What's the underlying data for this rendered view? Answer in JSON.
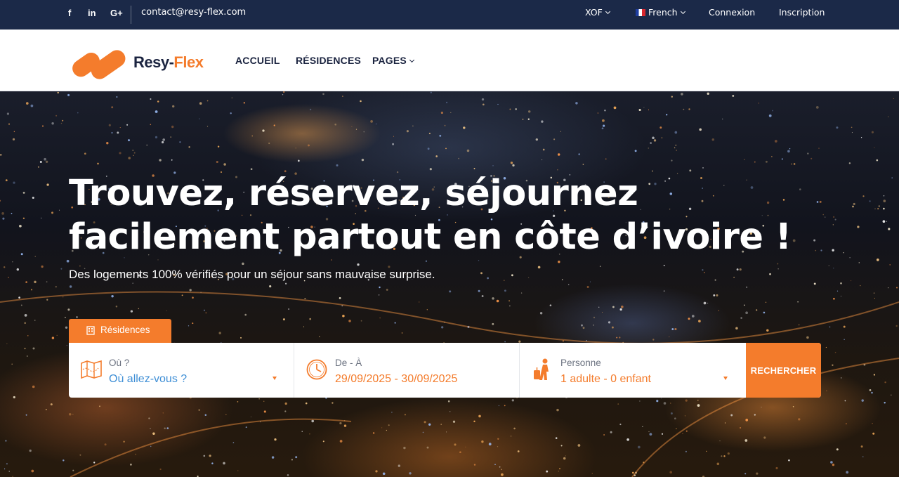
{
  "topbar": {
    "social": {
      "facebook": "f",
      "linkedin": "in",
      "google": "G+"
    },
    "email": "contact@resy-flex.com",
    "currency": "XOF",
    "language": "French",
    "login": "Connexion",
    "signup": "Inscription"
  },
  "brand": {
    "name_main": "Resy-",
    "name_accent": "Flex"
  },
  "nav": {
    "home": "ACCUEIL",
    "residences": "RÉSIDENCES",
    "pages": "PAGES"
  },
  "hero": {
    "title": "Trouvez, réservez, séjournez facilement partout en côte d’ivoire !",
    "subtitle": "Des logements 100% vérifiés pour un séjour sans mauvaise surprise."
  },
  "search": {
    "tab_label": "Résidences",
    "where_label": "Où ?",
    "where_value": "Où allez-vous ?",
    "dates_label": "De - À",
    "dates_value": "29/09/2025 - 30/09/2025",
    "guests_label": "Personne",
    "guests_value": "1 adulte - 0 enfant",
    "submit": "RECHERCHER"
  },
  "colors": {
    "accent": "#f47c2c",
    "navy": "#1b2948",
    "link_blue": "#3f8fd6"
  }
}
